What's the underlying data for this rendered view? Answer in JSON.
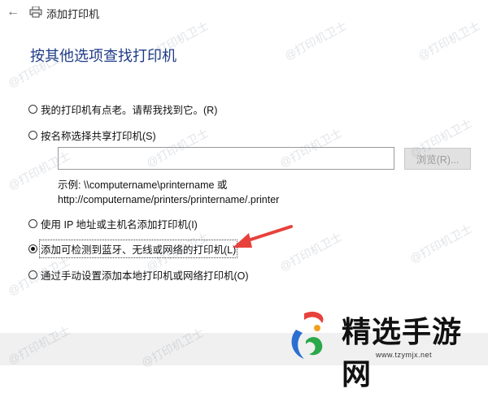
{
  "window": {
    "title": "添加打印机"
  },
  "heading": "按其他选项查找打印机",
  "options": [
    {
      "label": "我的打印机有点老。请帮我找到它。(R)",
      "checked": false
    },
    {
      "label": "按名称选择共享打印机(S)",
      "checked": false
    },
    {
      "label": "使用 IP 地址或主机名添加打印机(I)",
      "checked": false
    },
    {
      "label": "添加可检测到蓝牙、无线或网络的打印机(L)",
      "checked": true
    },
    {
      "label": "通过手动设置添加本地打印机或网络打印机(O)",
      "checked": false
    }
  ],
  "share": {
    "value": "",
    "browse_label": "浏览(R)..."
  },
  "example": {
    "line1": "示例: \\\\computername\\printername 或",
    "line2": "http://computername/printers/printername/.printer"
  },
  "watermark": "@打印机卫士",
  "brand": {
    "name": "精选手游网",
    "url": "www.tzymjx.net"
  },
  "colors": {
    "heading": "#1f3c88",
    "arrow": "#e8413c",
    "footer_bg": "#f0f0f0"
  }
}
